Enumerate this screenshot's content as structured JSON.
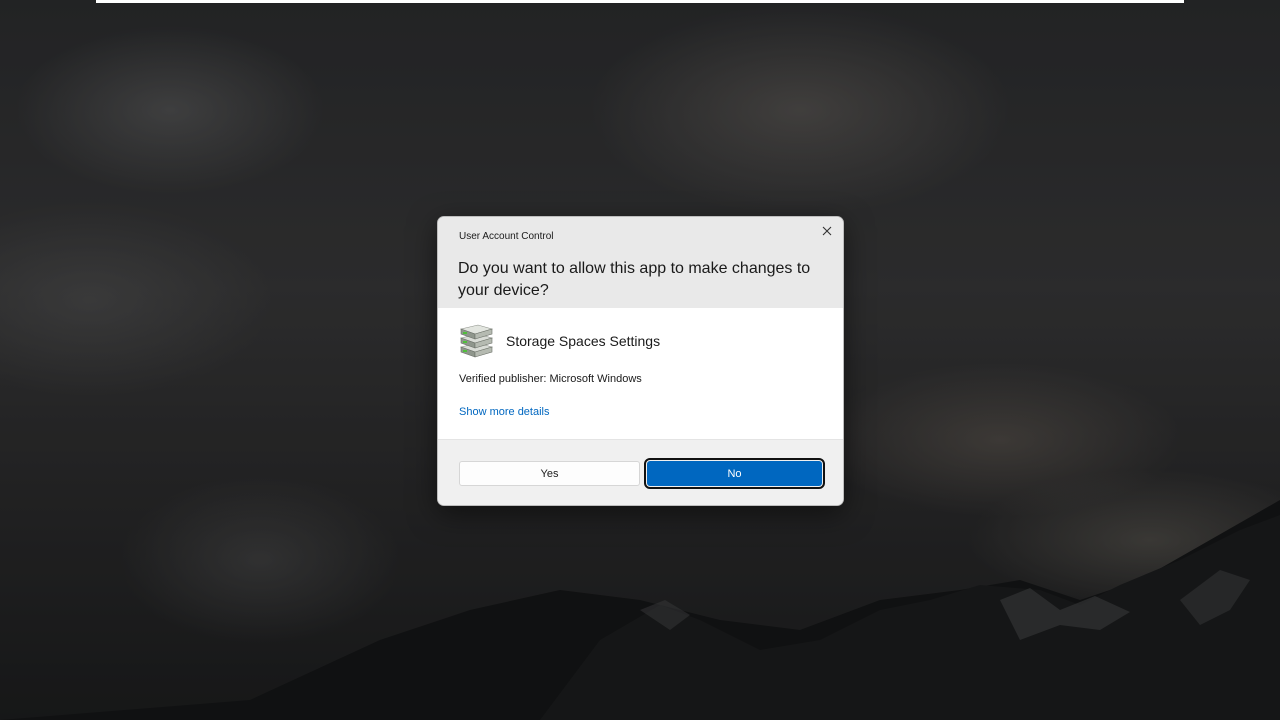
{
  "dialog": {
    "title": "User Account Control",
    "question": "Do you want to allow this app to make changes to your device?",
    "app_name": "Storage Spaces Settings",
    "app_icon": "storage-drives-icon",
    "publisher": "Verified publisher: Microsoft Windows",
    "details_link": "Show more details",
    "close_icon": "close-icon",
    "close_symbol": "✕",
    "buttons": {
      "yes": "Yes",
      "no": "No"
    }
  },
  "colors": {
    "accent": "#0067c0",
    "header_bg": "#e9e9e9",
    "footer_bg": "#f0f0f0",
    "link": "#0067c0"
  }
}
